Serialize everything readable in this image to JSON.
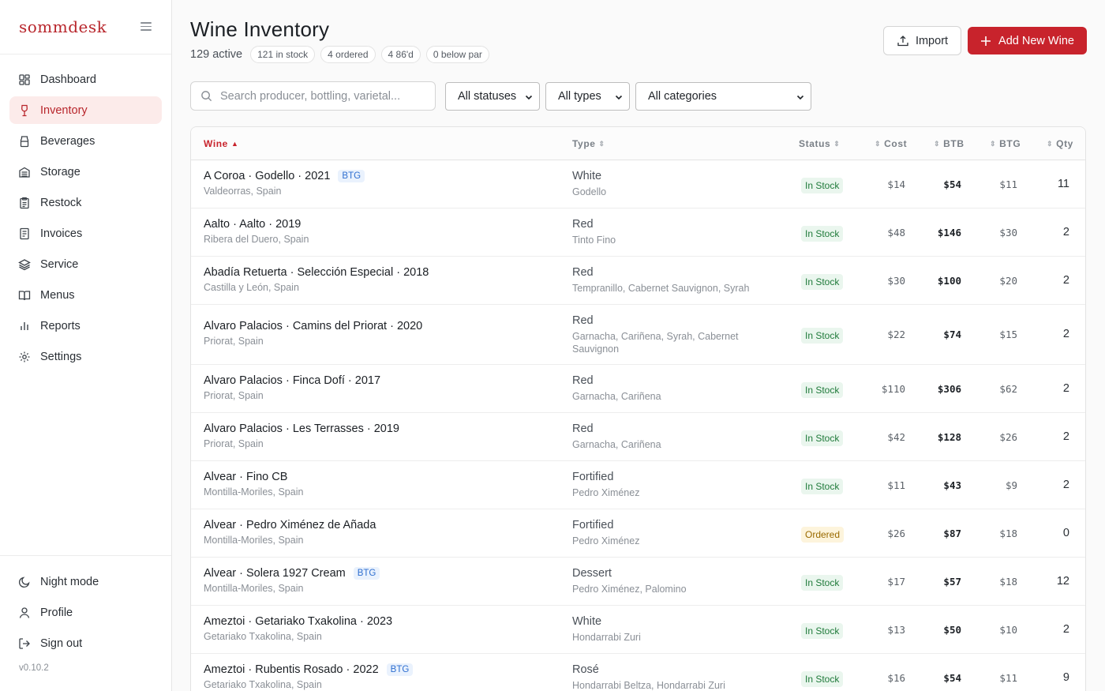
{
  "app": {
    "brand": "sommdesk",
    "version": "v0.10.2"
  },
  "nav": [
    {
      "label": "Dashboard",
      "icon": "dashboard-icon",
      "active": false
    },
    {
      "label": "Inventory",
      "icon": "wine-glass-icon",
      "active": true
    },
    {
      "label": "Beverages",
      "icon": "bottle-icon",
      "active": false
    },
    {
      "label": "Storage",
      "icon": "storage-icon",
      "active": false
    },
    {
      "label": "Restock",
      "icon": "clipboard-icon",
      "active": false
    },
    {
      "label": "Invoices",
      "icon": "receipt-icon",
      "active": false
    },
    {
      "label": "Service",
      "icon": "layers-icon",
      "active": false
    },
    {
      "label": "Menus",
      "icon": "book-icon",
      "active": false
    },
    {
      "label": "Reports",
      "icon": "bar-chart-icon",
      "active": false
    },
    {
      "label": "Settings",
      "icon": "gear-icon",
      "active": false
    }
  ],
  "bottom_nav": [
    {
      "label": "Night mode",
      "icon": "moon-icon"
    },
    {
      "label": "Profile",
      "icon": "user-icon"
    },
    {
      "label": "Sign out",
      "icon": "sign-out-icon"
    }
  ],
  "header": {
    "title": "Wine Inventory",
    "active_count": "129 active",
    "pills": [
      "121 in stock",
      "4 ordered",
      "4 86'd",
      "0 below par"
    ],
    "import_label": "Import",
    "add_label": "Add New Wine"
  },
  "filters": {
    "search_placeholder": "Search producer, bottling, varietal...",
    "status": "All statuses",
    "type": "All types",
    "category": "All categories"
  },
  "colors": {
    "accent": "#c8232c",
    "in_stock": "#1f7a3a",
    "ordered": "#9a6a00",
    "btg": "#2f6fd0"
  },
  "table": {
    "columns": {
      "wine": "Wine",
      "type": "Type",
      "status": "Status",
      "cost": "Cost",
      "btb": "BTB",
      "btg": "BTG",
      "qty": "Qty"
    },
    "rows": [
      {
        "name": "A Coroa · Godello · 2021",
        "btg_badge": "BTG",
        "region": "Valdeorras, Spain",
        "type": "White",
        "varietal": "Godello",
        "status": "In Stock",
        "cost": "$14",
        "btb": "$54",
        "btg": "$11",
        "qty": "11"
      },
      {
        "name": "Aalto · Aalto · 2019",
        "btg_badge": "",
        "region": "Ribera del Duero, Spain",
        "type": "Red",
        "varietal": "Tinto Fino",
        "status": "In Stock",
        "cost": "$48",
        "btb": "$146",
        "btg": "$30",
        "qty": "2"
      },
      {
        "name": "Abadía Retuerta · Selección Especial · 2018",
        "btg_badge": "",
        "region": "Castilla y León, Spain",
        "type": "Red",
        "varietal": "Tempranillo, Cabernet Sauvignon, Syrah",
        "status": "In Stock",
        "cost": "$30",
        "btb": "$100",
        "btg": "$20",
        "qty": "2"
      },
      {
        "name": "Alvaro Palacios · Camins del Priorat · 2020",
        "btg_badge": "",
        "region": "Priorat, Spain",
        "type": "Red",
        "varietal": "Garnacha, Cariñena, Syrah, Cabernet Sauvignon",
        "status": "In Stock",
        "cost": "$22",
        "btb": "$74",
        "btg": "$15",
        "qty": "2"
      },
      {
        "name": "Alvaro Palacios · Finca Dofí · 2017",
        "btg_badge": "",
        "region": "Priorat, Spain",
        "type": "Red",
        "varietal": "Garnacha, Cariñena",
        "status": "In Stock",
        "cost": "$110",
        "btb": "$306",
        "btg": "$62",
        "qty": "2"
      },
      {
        "name": "Alvaro Palacios · Les Terrasses · 2019",
        "btg_badge": "",
        "region": "Priorat, Spain",
        "type": "Red",
        "varietal": "Garnacha, Cariñena",
        "status": "In Stock",
        "cost": "$42",
        "btb": "$128",
        "btg": "$26",
        "qty": "2"
      },
      {
        "name": "Alvear · Fino CB",
        "btg_badge": "",
        "region": "Montilla-Moriles, Spain",
        "type": "Fortified",
        "varietal": "Pedro Ximénez",
        "status": "In Stock",
        "cost": "$11",
        "btb": "$43",
        "btg": "$9",
        "qty": "2"
      },
      {
        "name": "Alvear · Pedro Ximénez de Añada",
        "btg_badge": "",
        "region": "Montilla-Moriles, Spain",
        "type": "Fortified",
        "varietal": "Pedro Ximénez",
        "status": "Ordered",
        "cost": "$26",
        "btb": "$87",
        "btg": "$18",
        "qty": "0"
      },
      {
        "name": "Alvear · Solera 1927 Cream",
        "btg_badge": "BTG",
        "region": "Montilla-Moriles, Spain",
        "type": "Dessert",
        "varietal": "Pedro Ximénez, Palomino",
        "status": "In Stock",
        "cost": "$17",
        "btb": "$57",
        "btg": "$18",
        "qty": "12"
      },
      {
        "name": "Ameztoi · Getariako Txakolina · 2023",
        "btg_badge": "",
        "region": "Getariako Txakolina, Spain",
        "type": "White",
        "varietal": "Hondarrabi Zuri",
        "status": "In Stock",
        "cost": "$13",
        "btb": "$50",
        "btg": "$10",
        "qty": "2"
      },
      {
        "name": "Ameztoi · Rubentis Rosado · 2022",
        "btg_badge": "BTG",
        "region": "Getariako Txakolina, Spain",
        "type": "Rosé",
        "varietal": "Hondarrabi Beltza, Hondarrabi Zuri",
        "status": "In Stock",
        "cost": "$16",
        "btb": "$54",
        "btg": "$11",
        "qty": "9"
      }
    ]
  }
}
